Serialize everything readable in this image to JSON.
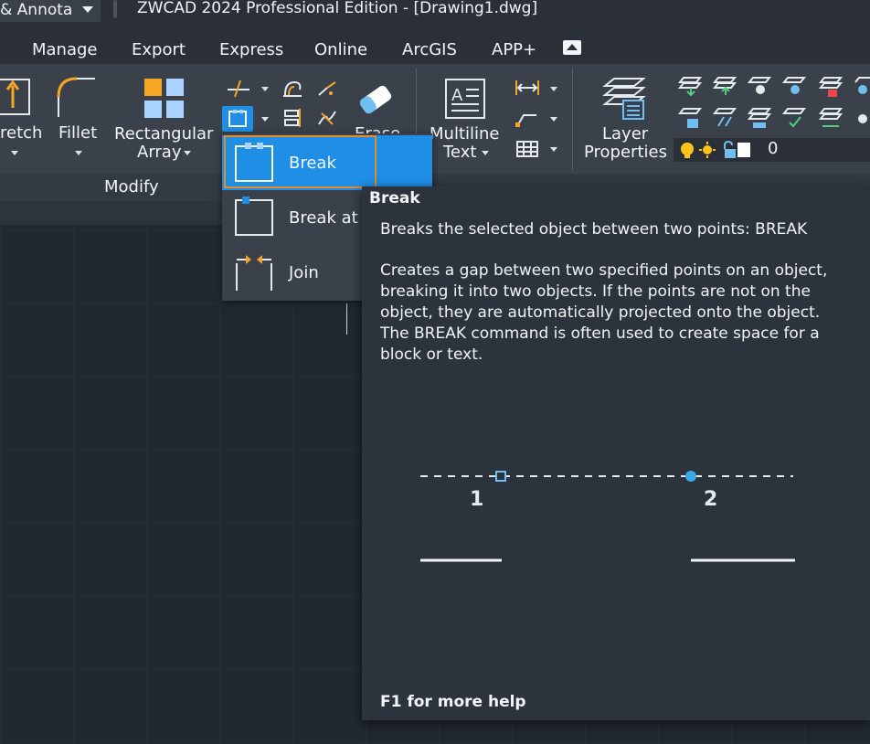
{
  "titlebar": {
    "workspace": "& Annota",
    "title": "ZWCAD 2024 Professional Edition - [Drawing1.dwg]"
  },
  "menu": [
    "Manage",
    "Export",
    "Express",
    "Online",
    "ArcGIS",
    "APP+"
  ],
  "ribbon": {
    "stretch": "retch",
    "fillet": "Fillet",
    "rect_array_line1": "Rectangular",
    "rect_array_line2": "Array",
    "erase": "Erase",
    "mtext_line1": "Multiline",
    "mtext_line2": "Text",
    "layer_props_line1": "Layer",
    "layer_props_line2": "Properties",
    "layer_value": "0",
    "modify_panel": "Modify"
  },
  "dropdown": {
    "items": [
      "Break",
      "Break at I",
      "Join"
    ]
  },
  "tooltip": {
    "title": "Break",
    "short": "Breaks the selected object between two points: BREAK",
    "description": "Creates a gap between two specified points on an object,\nbreaking it into two objects. If the points are not on the\nobject, they are automatically projected onto the object.\nThe BREAK command is often used to create space for a\nblock or text.",
    "point1": "1",
    "point2": "2",
    "help": "F1 for more help"
  },
  "colors": {
    "accent_blue": "#1f8fe6",
    "highlight_orange": "#e58b2a",
    "ribbon_bg": "#3a414b",
    "canvas_bg": "#212830"
  }
}
